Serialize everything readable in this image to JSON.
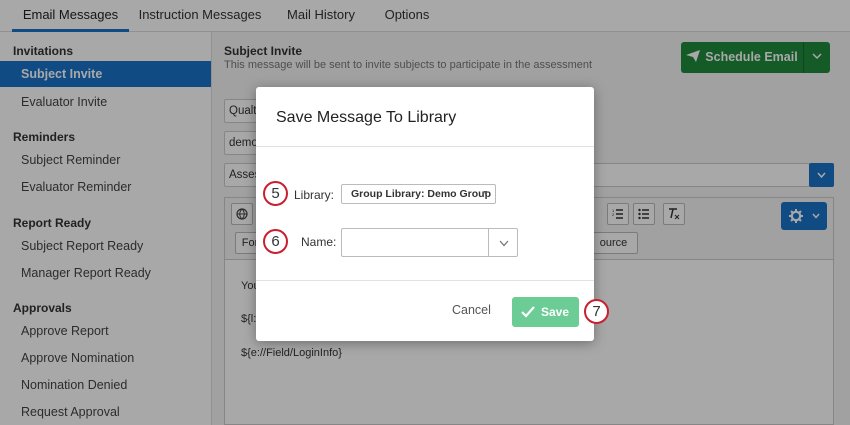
{
  "tabs": [
    {
      "label": "Email Messages",
      "active": true
    },
    {
      "label": "Instruction Messages",
      "active": false
    },
    {
      "label": "Mail History",
      "active": false
    },
    {
      "label": "Options",
      "active": false
    }
  ],
  "sidebar": {
    "sections": [
      {
        "heading": "Invitations",
        "items": [
          "Subject Invite",
          "Evaluator Invite"
        ]
      },
      {
        "heading": "Reminders",
        "items": [
          "Subject Reminder",
          "Evaluator Reminder"
        ]
      },
      {
        "heading": "Report Ready",
        "items": [
          "Subject Report Ready",
          "Manager Report Ready"
        ]
      },
      {
        "heading": "Approvals",
        "items": [
          "Approve Report",
          "Approve Nomination",
          "Nomination Denied",
          "Request Approval"
        ]
      }
    ],
    "active_item": "Subject Invite"
  },
  "main": {
    "title": "Subject Invite",
    "description": "This message will be sent to invite subjects to participate in the assessment",
    "schedule_button": "Schedule Email",
    "fields": [
      "Qualt",
      "demo",
      "Asses"
    ],
    "toolbar": {
      "row2_left": "For",
      "row2_right": "ource"
    },
    "editor_lines": [
      "You",
      "${l:",
      "${e://Field/LoginInfo}"
    ]
  },
  "modal": {
    "title": "Save Message To Library",
    "library_label": "Library:",
    "library_value": "Group Library: Demo Group",
    "name_label": "Name:",
    "name_value": "",
    "cancel_label": "Cancel",
    "save_label": "Save",
    "steps": [
      "5",
      "6",
      "7"
    ]
  },
  "colors": {
    "accent": "#1a73c7",
    "schedule_green": "#1f8a3c",
    "save_green": "#6ccc95",
    "step_ring": "#c8202f"
  }
}
